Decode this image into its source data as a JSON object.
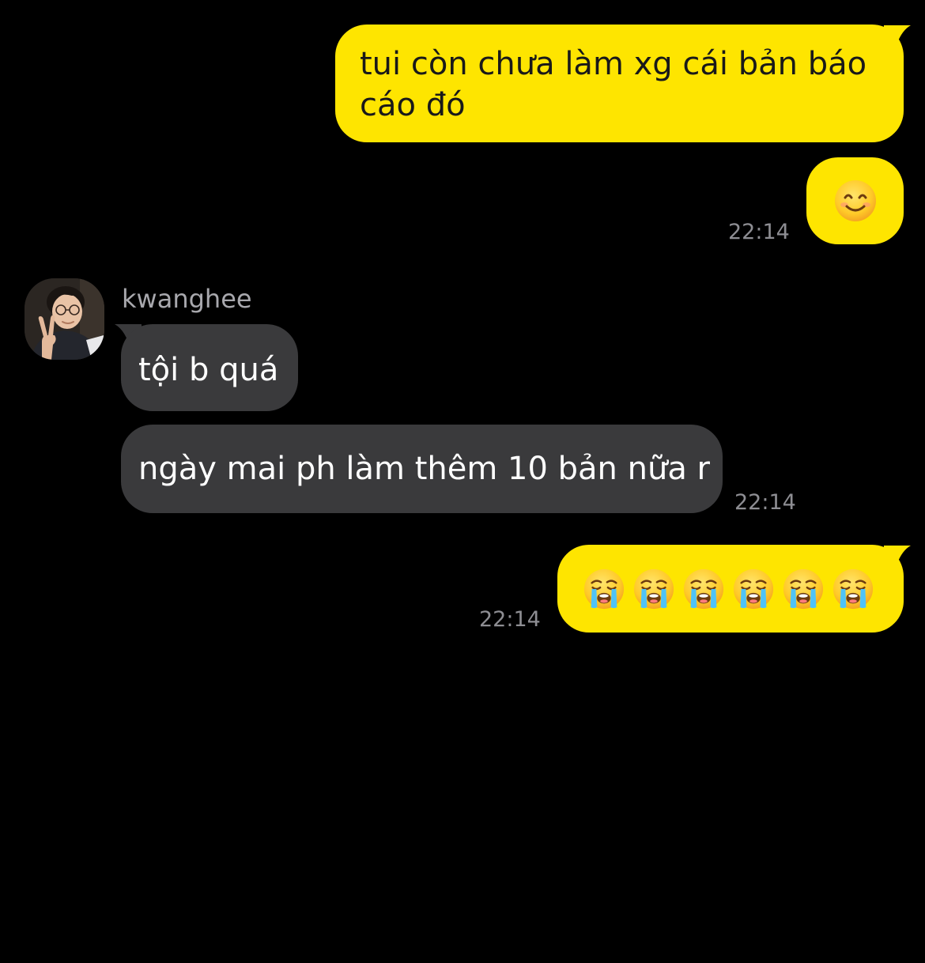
{
  "chat": {
    "messages": [
      {
        "direction": "outgoing",
        "text": "tui còn chưa làm xg cái bản báo cáo đó"
      },
      {
        "direction": "outgoing",
        "emoji": "smiling-face-with-smiling-eyes",
        "time": "22:14"
      },
      {
        "direction": "incoming",
        "sender": "kwanghee",
        "text": "tội b quá"
      },
      {
        "direction": "incoming",
        "text": "ngày mai ph làm thêm 10 bản nữa r",
        "time": "22:14"
      },
      {
        "direction": "outgoing",
        "emoji": "loudly-crying-face",
        "emoji_count": 6,
        "time": "22:14"
      }
    ]
  },
  "colors": {
    "background": "#000000",
    "outgoing_bubble": "#fee500",
    "incoming_bubble": "#3a3a3c",
    "timestamp": "#8e8e93",
    "sender_name": "#a8a8ad"
  }
}
